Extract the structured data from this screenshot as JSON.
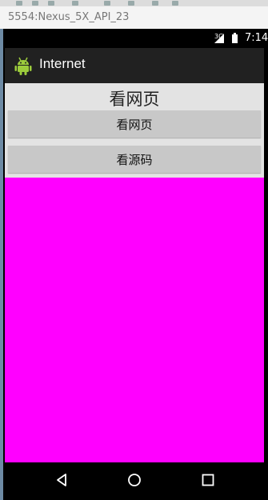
{
  "window": {
    "title": "5554:Nexus_5X_API_23"
  },
  "status_bar": {
    "network": "3G",
    "time": "7:14"
  },
  "app_bar": {
    "title": "Internet",
    "logo": "android-icon"
  },
  "content": {
    "heading": "看网页",
    "view_page_button": "看网页",
    "view_source_button": "看源码"
  },
  "webview": {
    "background": "#ff00ff"
  },
  "nav_bar": {
    "icons": [
      "back-icon",
      "home-icon",
      "recents-icon"
    ]
  },
  "colors": {
    "action_bar": "#212121",
    "button": "#c8c8c8"
  }
}
